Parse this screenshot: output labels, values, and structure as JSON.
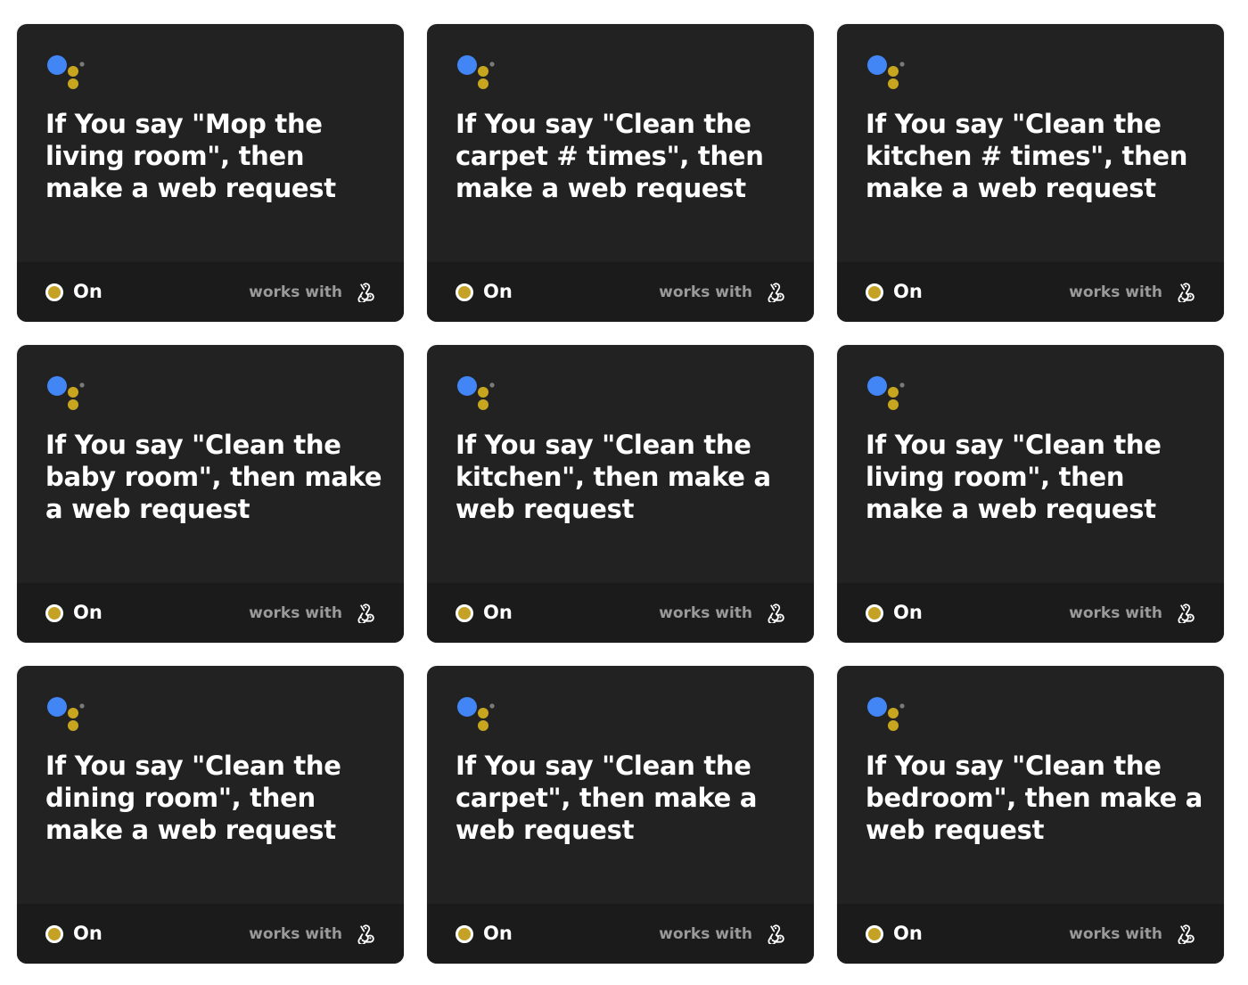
{
  "status_label": "On",
  "works_with_label": "works with",
  "colors": {
    "card_bg": "#222222",
    "footer_bg": "#1b1b1b",
    "assistant_blue": "#4285f4",
    "assistant_yellow": "#c8a51f",
    "status_on": "#c5a226"
  },
  "icons": {
    "trigger": "google-assistant-icon",
    "action": "webhooks-icon"
  },
  "applets": [
    {
      "title": "If You say \"Mop the living room\", then make a web request"
    },
    {
      "title": "If You say \"Clean the carpet # times\", then make a web request"
    },
    {
      "title": "If You say \"Clean the kitchen # times\", then make a web request"
    },
    {
      "title": "If You say \"Clean the baby room\", then make a web request"
    },
    {
      "title": "If You say \"Clean the kitchen\", then make a web request"
    },
    {
      "title": "If You say \"Clean the living room\", then make a web request"
    },
    {
      "title": "If You say \"Clean the dining room\", then make a web request"
    },
    {
      "title": "If You say \"Clean the carpet\", then make a web request"
    },
    {
      "title": "If You say \"Clean the bedroom\", then make a web request"
    }
  ]
}
